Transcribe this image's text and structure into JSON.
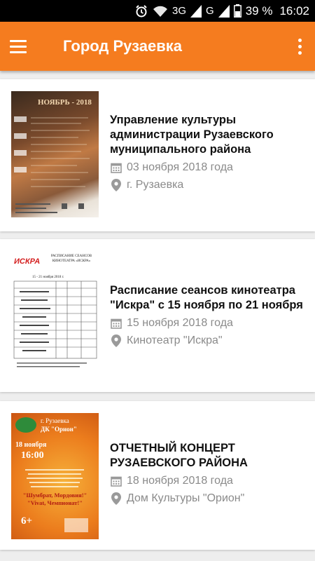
{
  "status_bar": {
    "network1": "3G",
    "network2": "G",
    "battery": "39 %",
    "time": "16:02"
  },
  "app_bar": {
    "title": "Город Рузаевка"
  },
  "events": [
    {
      "title": "Управление культуры администрации Рузаевского муниципального района",
      "date": "03 ноября 2018 года",
      "location": "г. Рузаевка",
      "thumb": {
        "heading": "НОЯБРЬ - 2018"
      }
    },
    {
      "title": "Расписание сеансов кинотеатра \"Искра\" с 15 ноября по 21 ноября",
      "date": "15 ноября 2018 года",
      "location": "Кинотеатр \"Искра\"",
      "thumb": {
        "brand": "ИСКРА",
        "heading": "РАСПИСАНИЕ СЕАНСОВ КИНОТЕАТРА «ИСКРА»",
        "dates": "15 - 21 ноября 2018 г."
      }
    },
    {
      "title": "ОТЧЕТНЫЙ КОНЦЕРТ РУЗАЕВСКОГО РАЙОНА",
      "date": "18 ноября 2018 года",
      "location": "Дом Культуры \"Орион\"",
      "thumb": {
        "city": "г. Рузаевка",
        "venue": "ДК \"Орион\"",
        "date": "18 ноября",
        "time": "16:00",
        "slogan": "\"Шумбрат, Мордовия!\" \"Vivat, Чемпионат!\"",
        "age": "6+"
      }
    }
  ],
  "colors": {
    "accent": "#f57c1f",
    "meta": "#8a8a8a"
  }
}
